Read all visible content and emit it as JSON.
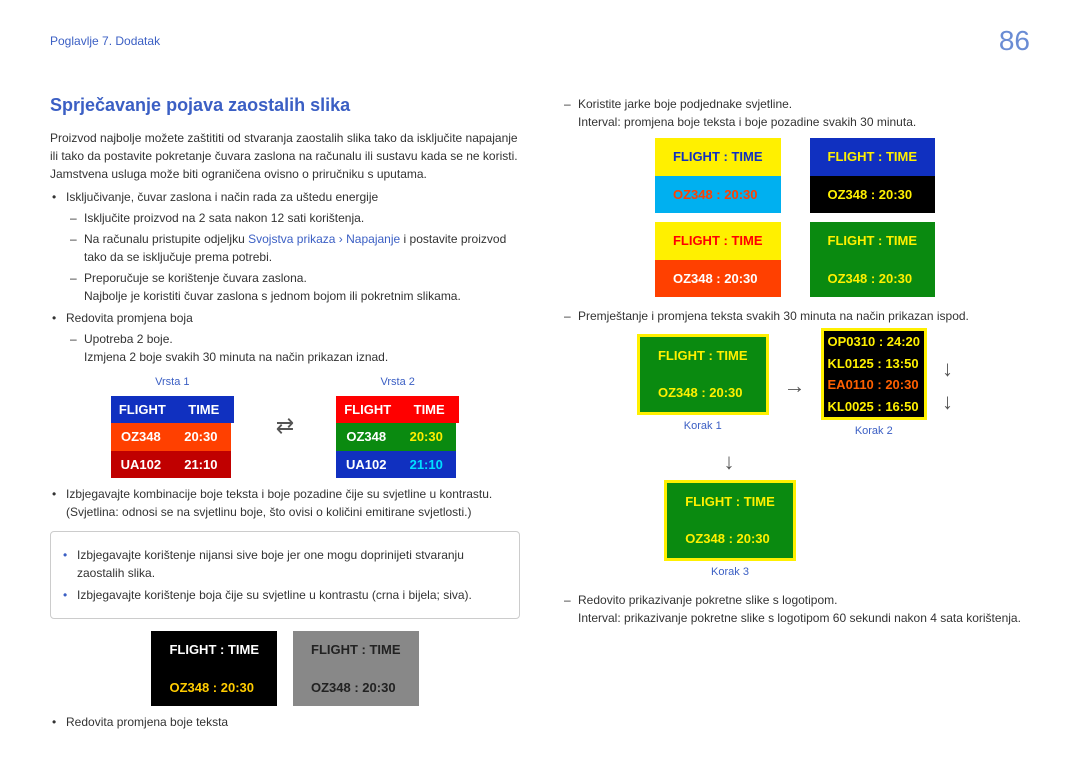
{
  "header": {
    "chapter": "Poglavlje 7. Dodatak",
    "page": "86"
  },
  "h2": "Sprječavanje pojava zaostalih slika",
  "intro": {
    "p1": "Proizvod najbolje možete zaštititi od stvaranja zaostalih slika tako da isključite napajanje ili tako da postavite pokretanje čuvara zaslona na računalu ili sustavu kada se ne koristi. Jamstvena usluga može biti ograničena ovisno o priručniku s uputama."
  },
  "b1": {
    "t": "Isključivanje, čuvar zaslona i način rada za uštedu energije",
    "d1": "Isključite proizvod na 2 sata nakon 12 sati korištenja.",
    "d2a": "Na računalu pristupite odjeljku ",
    "d2b": "Svojstva prikaza",
    "d2c": " › ",
    "d2d": "Napajanje",
    "d2e": " i postavite proizvod tako da se isključuje prema potrebi.",
    "d3": "Preporučuje se korištenje čuvara zaslona.",
    "d3b": "Najbolje je koristiti čuvar zaslona s jednom bojom ili pokretnim slikama."
  },
  "b2": {
    "t": "Redovita promjena boja",
    "d1": "Upotreba 2 boje.",
    "d1b": "Izmjena 2 boje svakih 30 minuta na način prikazan iznad."
  },
  "vrsta1": "Vrsta 1",
  "vrsta2": "Vrsta 2",
  "ft": {
    "flight": "FLIGHT",
    "time": "TIME",
    "oz": "OZ348",
    "t2030": "20:30",
    "ua": "UA102",
    "t2110": "21:10",
    "colon": ":",
    "ftsep": "FLIGHT   :   TIME",
    "ozsep": "OZ348   :   20:30"
  },
  "b3": "Izbjegavajte kombinacije boje teksta i boje pozadine čije su svjetline u kontrastu. (Svjetlina: odnosi se na svjetlinu boje, što ovisi o količini emitirane svjetlosti.)",
  "note": {
    "n1": "Izbjegavajte korištenje nijansi sive boje jer one mogu doprinijeti stvaranju zaostalih slika.",
    "n2": "Izbjegavajte korištenje boja čije su svjetline u kontrastu (crna i bijela; siva)."
  },
  "b4": "Redovita promjena boje teksta",
  "r1": "Koristite jarke boje podjednake svjetline.",
  "r1b": "Interval: promjena boje teksta i boje pozadine svakih 30 minuta.",
  "r2": "Premještanje i promjena teksta svakih 30 minuta na način prikazan ispod.",
  "korak1": "Korak 1",
  "korak2": "Korak 2",
  "korak3": "Korak 3",
  "scroll": {
    "l1": "OP0310   :   24:20",
    "l2": "KL0125   :   13:50",
    "l3": "EA0110   :   20:30",
    "l4": "KL0025   :   16:50"
  },
  "r3": "Redovito prikazivanje pokretne slike s logotipom.",
  "r3b": "Interval: prikazivanje pokretne slike s logotipom 60 sekundi nakon 4 sata korištenja."
}
